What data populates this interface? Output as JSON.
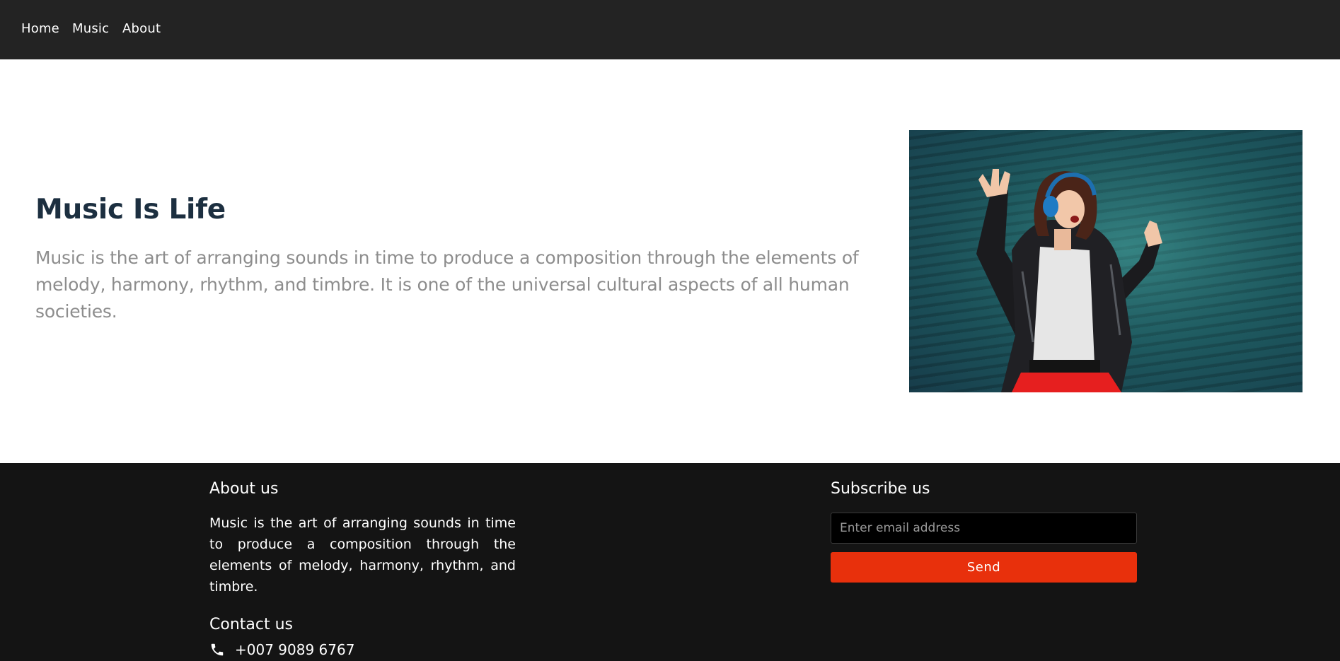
{
  "nav": {
    "items": [
      {
        "label": "Home"
      },
      {
        "label": "Music"
      },
      {
        "label": "About"
      }
    ]
  },
  "hero": {
    "title": "Music Is Life",
    "description": "Music is the art of arranging sounds in time to produce a composition through the elements of melody, harmony, rhythm, and timbre. It is one of the universal cultural aspects of all human societies."
  },
  "footer": {
    "about": {
      "heading": "About us",
      "text": "Music is the art of arranging sounds in time to produce a composition through the elements of melody, harmony, rhythm, and timbre."
    },
    "contact": {
      "heading": "Contact us",
      "phone": "+007 9089 6767",
      "icon": "phone-icon"
    },
    "subscribe": {
      "heading": "Subscribe us",
      "email_placeholder": "Enter email address",
      "email_value": "",
      "button_label": "Send"
    }
  },
  "colors": {
    "navbar_bg": "#232323",
    "footer_bg": "#141414",
    "title": "#1c2f40",
    "description": "#8d8d8d",
    "accent": "#e8300c"
  }
}
